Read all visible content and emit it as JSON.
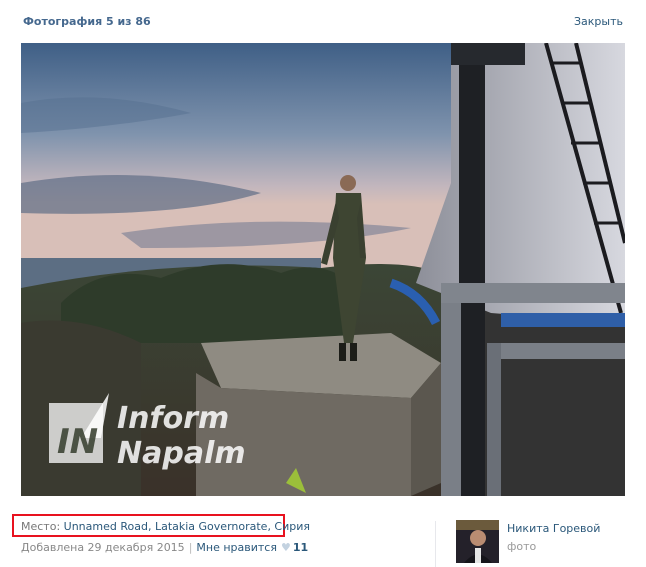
{
  "header": {
    "title": "Фотография 5 из 86",
    "close_label": "Закрыть"
  },
  "photo": {
    "watermark_line1": "Inform",
    "watermark_line2": "Napalm",
    "watermark_logo": "IN"
  },
  "details": {
    "place_label": "Место:",
    "place_value": "Unnamed Road, Latakia Governorate, Сирия",
    "added_text": "Добавлена 29 декабря 2015",
    "separator": "|",
    "like_label": "Мне нравится",
    "like_count": "11"
  },
  "author": {
    "name": "Никита Горевой",
    "subtitle": "фото"
  },
  "colors": {
    "link": "#2b587a",
    "highlight_border": "#e8121f"
  }
}
